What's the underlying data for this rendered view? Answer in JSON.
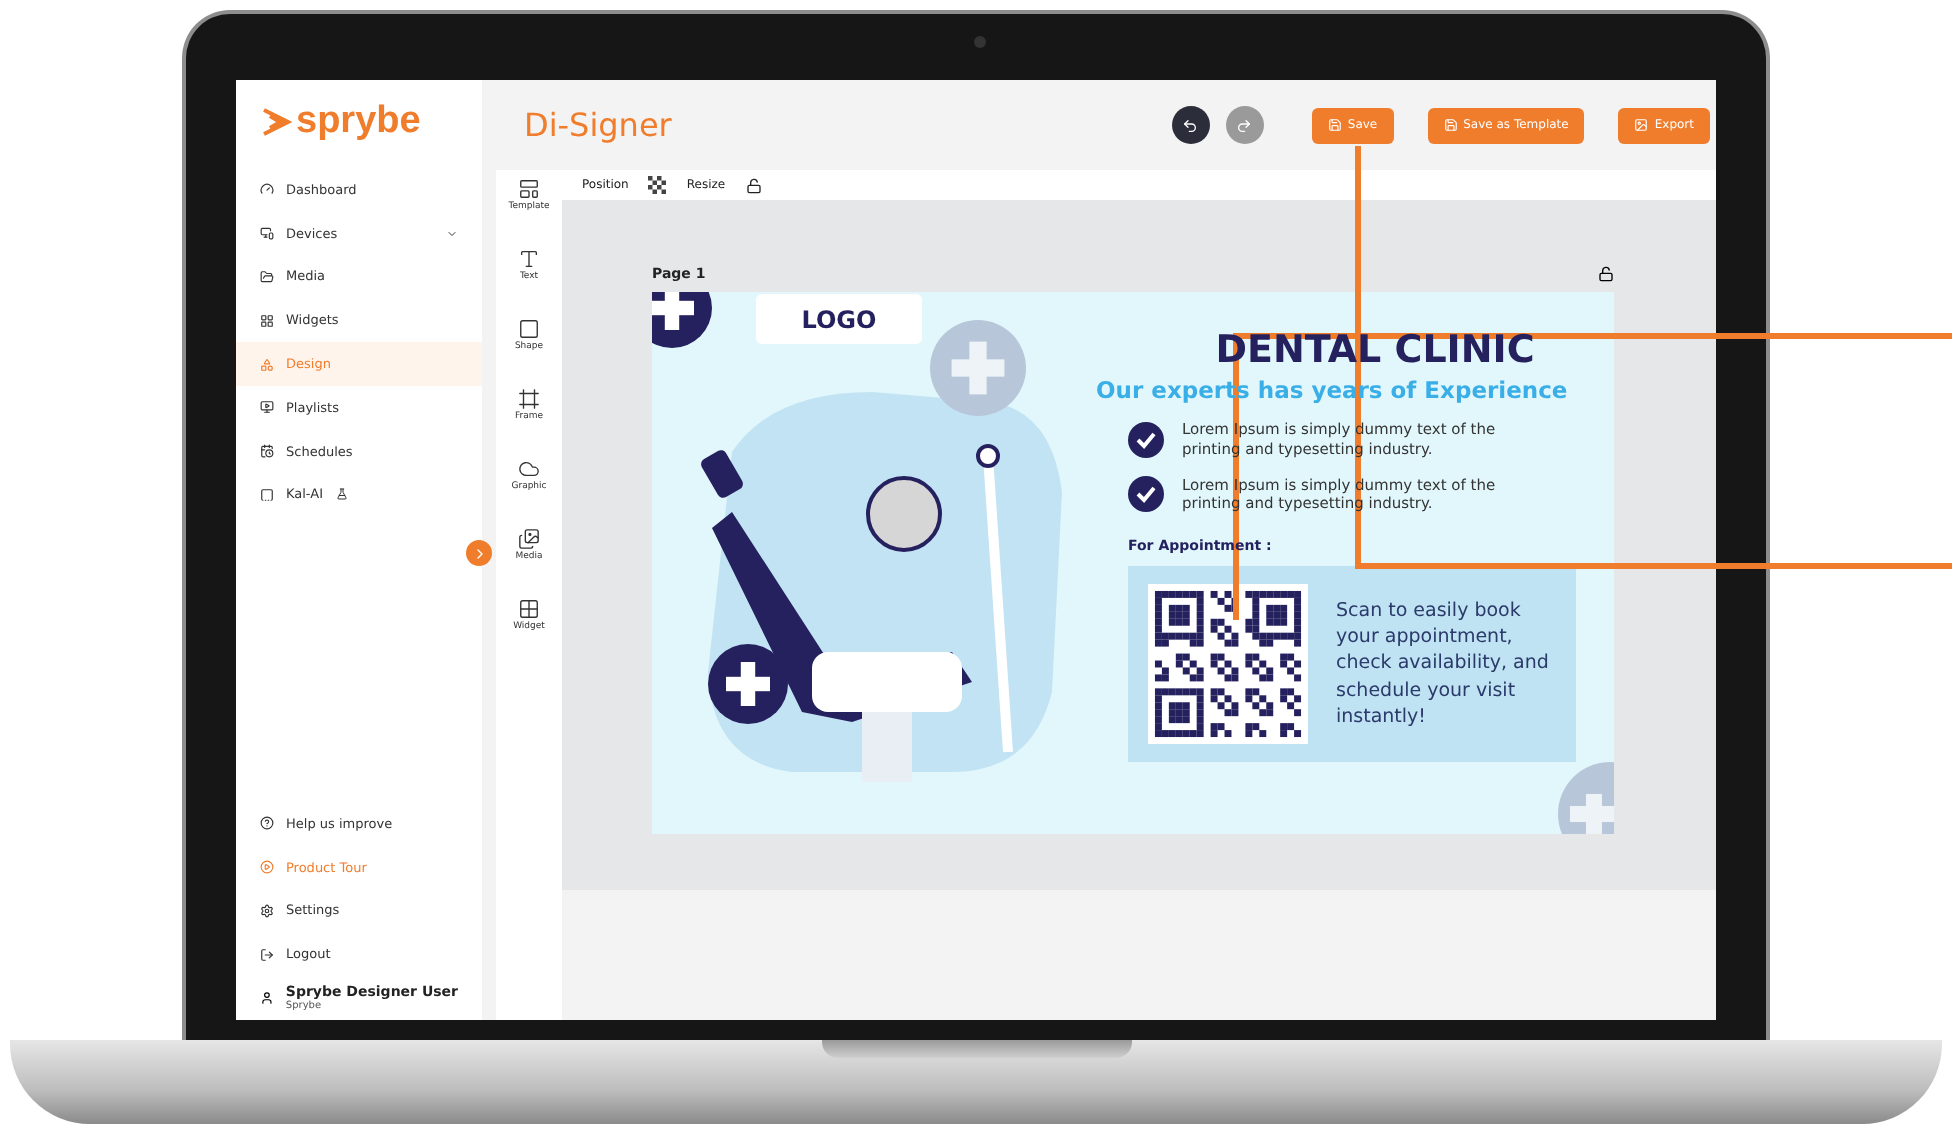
{
  "app": {
    "logo": "sprybe",
    "title": "Di-Signer"
  },
  "sidebar": {
    "items": [
      {
        "label": "Dashboard",
        "kind": "link",
        "selected": false
      },
      {
        "label": "Devices",
        "kind": "group",
        "selected": false
      },
      {
        "label": "Media",
        "kind": "link",
        "selected": false
      },
      {
        "label": "Widgets",
        "kind": "link",
        "selected": false
      },
      {
        "label": "Design",
        "kind": "link",
        "selected": true
      },
      {
        "label": "Playlists",
        "kind": "link",
        "selected": false
      },
      {
        "label": "Schedules",
        "kind": "link",
        "selected": false
      },
      {
        "label": "Kal-AI",
        "kind": "badge",
        "selected": false
      }
    ],
    "footer_items": [
      {
        "label": "Help us improve",
        "highlighted": false
      },
      {
        "label": "Product Tour",
        "highlighted": true
      },
      {
        "label": "Settings",
        "highlighted": false
      },
      {
        "label": "Logout",
        "highlighted": false
      }
    ],
    "user": {
      "name": "Sprybe Designer User",
      "org": "Sprybe"
    }
  },
  "header": {
    "history": [
      {
        "kind": "undo",
        "disabled": false
      },
      {
        "kind": "redo",
        "disabled": true
      }
    ],
    "buttons": [
      {
        "label": "Save",
        "kind": "save"
      },
      {
        "label": "Save as Template",
        "kind": "save"
      },
      {
        "label": "Export",
        "kind": "export"
      }
    ]
  },
  "tools": [
    {
      "label": "Template",
      "kind": "template"
    },
    {
      "label": "Text",
      "kind": "text"
    },
    {
      "label": "Shape",
      "kind": "shape"
    },
    {
      "label": "Frame",
      "kind": "frame"
    },
    {
      "label": "Graphic",
      "kind": "graphic"
    },
    {
      "label": "Media",
      "kind": "media"
    },
    {
      "label": "Widget",
      "kind": "widget"
    }
  ],
  "toolbar": {
    "position": "Position",
    "resize": "Resize"
  },
  "page": {
    "label": "Page 1",
    "design": {
      "logo": "LOGO",
      "title": "DENTAL CLINIC",
      "subtitle": "Our experts has years of Experience",
      "bullets": [
        "Lorem Ipsum is simply dummy text of the printing and typesetting industry.",
        "Lorem Ipsum is simply dummy text of the printing and typesetting industry."
      ],
      "appointment_label": "For Appointment :",
      "qr_text": "Scan to easily book your appointment, check availability, and schedule your visit instantly!"
    }
  }
}
